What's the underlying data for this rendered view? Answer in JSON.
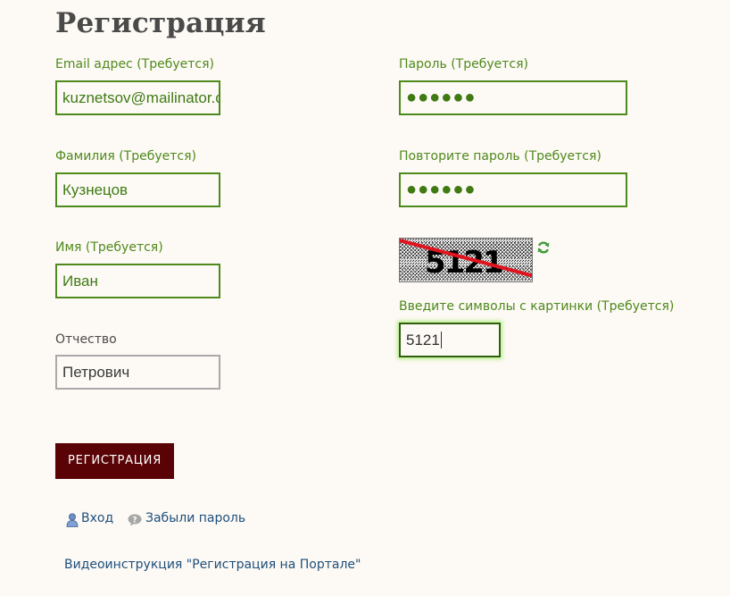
{
  "page": {
    "title": "Регистрация"
  },
  "form": {
    "email": {
      "label": "Email адрес (Требуется)",
      "value": "kuznetsov@mailinator.com"
    },
    "last_name": {
      "label": "Фамилия (Требуется)",
      "value": "Кузнецов"
    },
    "first_name": {
      "label": "Имя (Требуется)",
      "value": "Иван"
    },
    "middle_name": {
      "label": "Отчество",
      "value": "Петрович"
    },
    "password": {
      "label": "Пароль (Требуется)",
      "value": "●●●●●●"
    },
    "password_repeat": {
      "label": "Повторите пароль (Требуется)",
      "value": "●●●●●●"
    },
    "captcha": {
      "label": "Введите символы с картинки (Требуется)",
      "value": "5121",
      "image_text": "5121",
      "refresh_icon": "refresh-icon"
    },
    "submit_label": "РЕГИСТРАЦИЯ"
  },
  "links": {
    "login": {
      "label": "Вход",
      "icon": "user-icon"
    },
    "forgot_password": {
      "label": "Забыли пароль",
      "icon": "question-bubble-icon"
    },
    "video_instruction": "Видеоинструкция \"Регистрация на Портале\""
  },
  "colors": {
    "accent_green": "#4e8a1c",
    "button_bg": "#5a0306",
    "link_blue": "#1d4f7d",
    "background": "#fdf9f4"
  }
}
